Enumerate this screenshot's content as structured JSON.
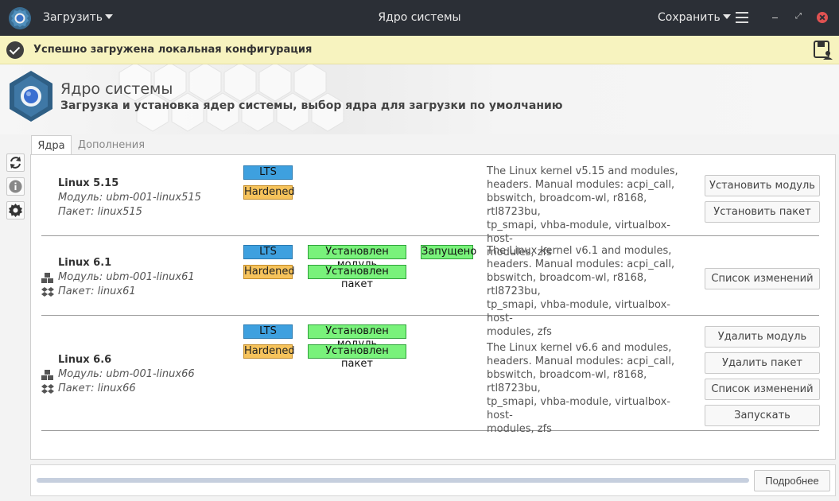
{
  "window": {
    "title": "Ядро системы",
    "load_menu": "Загрузить",
    "save_menu": "Сохранить"
  },
  "notification": {
    "text": "Успешно загружена локальная конфигурация"
  },
  "header": {
    "title": "Ядро системы",
    "subtitle": "Загрузка и установка ядер системы, выбор ядра для загрузки по умолчанию"
  },
  "tabs": [
    {
      "label": "Ядра",
      "active": true
    },
    {
      "label": "Дополнения",
      "active": false
    }
  ],
  "kernels": [
    {
      "name": "Linux 5.15",
      "module": "Модуль: ubm-001-linux515",
      "package": "Пакет: linux515",
      "tags": [
        "LTS",
        "Hardened"
      ],
      "description": [
        "The Linux kernel v5.15 and modules,",
        "headers. Manual modules: acpi_call,",
        "bbswitch, broadcom-wl, r8168, rtl8723bu,",
        "tp_smapi, vhba-module, virtualbox-host-",
        "modules, zfs"
      ],
      "buttons": [
        "Установить модуль",
        "Установить пакет"
      ]
    },
    {
      "name": "Linux 6.1",
      "module": "Модуль: ubm-001-linux61",
      "package": "Пакет: linux61",
      "tags": [
        "LTS",
        "Hardened"
      ],
      "status": [
        "Установлен модуль",
        "Установлен пакет",
        "Запущено"
      ],
      "description": [
        "The Linux kernel v6.1 and modules,",
        "headers. Manual modules: acpi_call,",
        "bbswitch, broadcom-wl, r8168, rtl8723bu,",
        "tp_smapi, vhba-module, virtualbox-host-",
        "modules, zfs"
      ],
      "buttons": [
        "Список изменений"
      ]
    },
    {
      "name": "Linux 6.6",
      "module": "Модуль: ubm-001-linux66",
      "package": "Пакет: linux66",
      "tags": [
        "LTS",
        "Hardened"
      ],
      "status": [
        "Установлен модуль",
        "Установлен пакет"
      ],
      "description": [
        "The Linux kernel v6.6 and modules,",
        "headers. Manual modules: acpi_call,",
        "bbswitch, broadcom-wl, r8168, rtl8723bu,",
        "tp_smapi, vhba-module, virtualbox-host-",
        "modules, zfs"
      ],
      "buttons": [
        "Удалить модуль",
        "Удалить пакет",
        "Список изменений",
        "Запускать"
      ]
    }
  ],
  "footer": {
    "details_button": "Подробнее"
  },
  "colors": {
    "titlebar": "#2b2f36",
    "notice": "#f7f3bf",
    "lts": "#3ea0df",
    "hardened": "#f6c35b",
    "installed": "#79f27b"
  }
}
